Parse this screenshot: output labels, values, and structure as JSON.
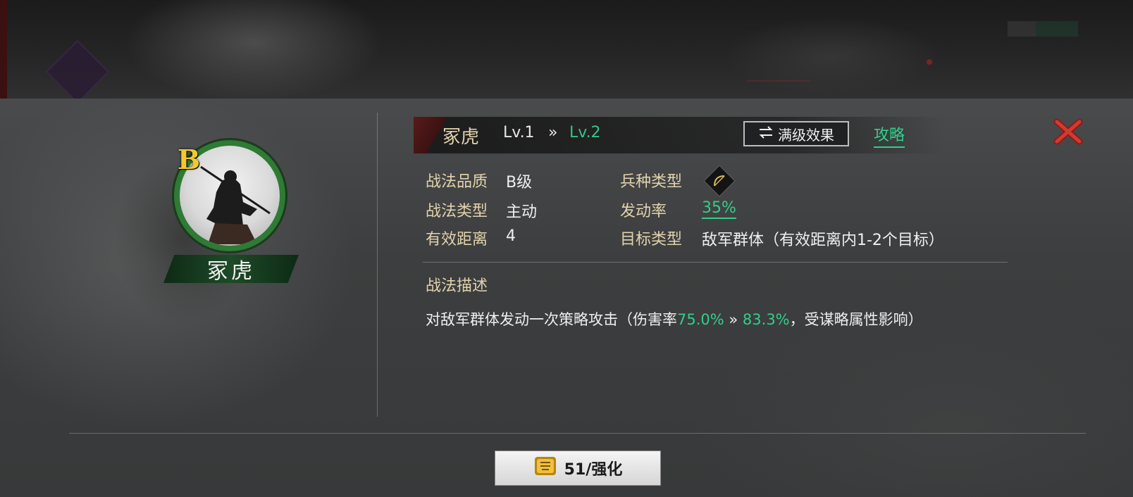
{
  "skill": {
    "name": "冢虎",
    "grade": "B",
    "level_current": "Lv.1",
    "level_arrow": "»",
    "level_next": "Lv.2"
  },
  "header": {
    "max_effect_label": "满级效果",
    "guide_label": "攻略"
  },
  "attributes": {
    "quality_label": "战法品质",
    "quality_value": "B级",
    "type_label": "战法类型",
    "type_value": "主动",
    "range_label": "有效距离",
    "range_value": "4",
    "troop_label": "兵种类型",
    "rate_label": "发动率",
    "rate_value": "35%",
    "target_label": "目标类型",
    "target_value": "敌军群体（有效距离内1-2个目标）"
  },
  "description": {
    "title": "战法描述",
    "prefix": "对敌军群体发动一次策略攻击（伤害率",
    "damage_from": "75.0%",
    "arrow": " » ",
    "damage_to": "83.3%",
    "suffix": "，受谋略属性影响）"
  },
  "upgrade": {
    "label": "51/强化"
  },
  "colors": {
    "accent_green": "#2fd08b",
    "label_gold": "#e2d3ad",
    "grade_yellow": "#f2c830",
    "close_red": "#c0302a"
  },
  "icons": {
    "swap": "swap-icon",
    "close": "close-icon",
    "troop": "bow-icon",
    "upgrade": "fist-icon"
  }
}
